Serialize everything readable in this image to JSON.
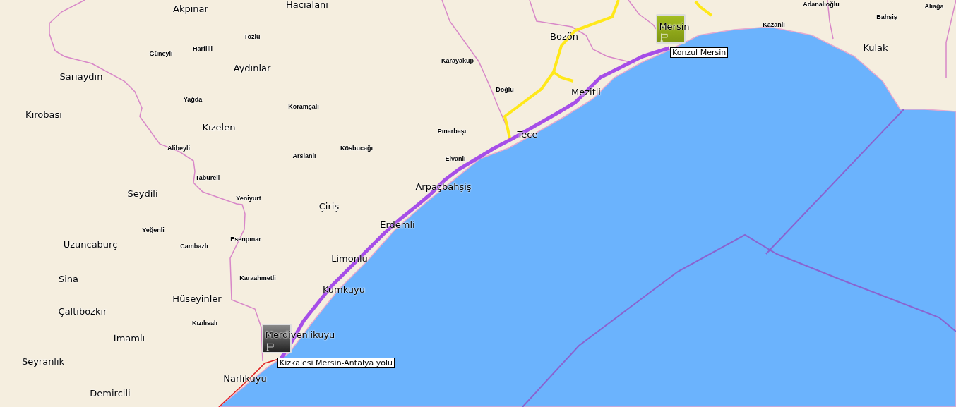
{
  "places": [
    {
      "name": "Akpınar",
      "kind": "town"
    },
    {
      "name": "Hacıalanı",
      "kind": "town"
    },
    {
      "name": "Adanalıoğlu",
      "kind": "village"
    },
    {
      "name": "Aliağa",
      "kind": "village"
    },
    {
      "name": "Bahşiş",
      "kind": "village"
    },
    {
      "name": "Tozlu",
      "kind": "village"
    },
    {
      "name": "Bozön",
      "kind": "town"
    },
    {
      "name": "Mersin",
      "kind": "town"
    },
    {
      "name": "Kazanlı",
      "kind": "village"
    },
    {
      "name": "Güneyli",
      "kind": "village"
    },
    {
      "name": "Harfilli",
      "kind": "village"
    },
    {
      "name": "Kulak",
      "kind": "town"
    },
    {
      "name": "Karayakup",
      "kind": "village"
    },
    {
      "name": "Sarıaydın",
      "kind": "town"
    },
    {
      "name": "Aydınlar",
      "kind": "town"
    },
    {
      "name": "Yağda",
      "kind": "village"
    },
    {
      "name": "Doğlu",
      "kind": "village"
    },
    {
      "name": "Mezitli",
      "kind": "town"
    },
    {
      "name": "Kırobası",
      "kind": "town"
    },
    {
      "name": "Koramşalı",
      "kind": "village"
    },
    {
      "name": "Kızelen",
      "kind": "town"
    },
    {
      "name": "Pınarbaşı",
      "kind": "village"
    },
    {
      "name": "Tece",
      "kind": "town"
    },
    {
      "name": "Alibeyli",
      "kind": "village"
    },
    {
      "name": "Arslanlı",
      "kind": "village"
    },
    {
      "name": "Kösbucağı",
      "kind": "village"
    },
    {
      "name": "Elvanlı",
      "kind": "village"
    },
    {
      "name": "Tabureli",
      "kind": "village"
    },
    {
      "name": "Arpaçbahşiş",
      "kind": "town"
    },
    {
      "name": "Seydili",
      "kind": "town"
    },
    {
      "name": "Yeniyurt",
      "kind": "village"
    },
    {
      "name": "Çiriş",
      "kind": "town"
    },
    {
      "name": "Yeğenli",
      "kind": "village"
    },
    {
      "name": "Erdemli",
      "kind": "town"
    },
    {
      "name": "Uzuncaburç",
      "kind": "town"
    },
    {
      "name": "Cambazlı",
      "kind": "village"
    },
    {
      "name": "Esenpınar",
      "kind": "village"
    },
    {
      "name": "Limonlu",
      "kind": "town"
    },
    {
      "name": "Sina",
      "kind": "town"
    },
    {
      "name": "Karaahmetli",
      "kind": "village"
    },
    {
      "name": "Kumkuyu",
      "kind": "town"
    },
    {
      "name": "Hüseyinler",
      "kind": "town"
    },
    {
      "name": "Çaltıbozkır",
      "kind": "town"
    },
    {
      "name": "Kızılısalı",
      "kind": "village"
    },
    {
      "name": "İmamlı",
      "kind": "town"
    },
    {
      "name": "Merdivenlikuyu",
      "kind": "town"
    },
    {
      "name": "Seyranlık",
      "kind": "town"
    },
    {
      "name": "Narlıkuyu",
      "kind": "town"
    },
    {
      "name": "Demircili",
      "kind": "town"
    }
  ],
  "markers": [
    {
      "kind": "end",
      "label": "Konzul Mersin"
    },
    {
      "kind": "start",
      "label": "Kizkalesi Mersin-Antalya yolu"
    }
  ]
}
